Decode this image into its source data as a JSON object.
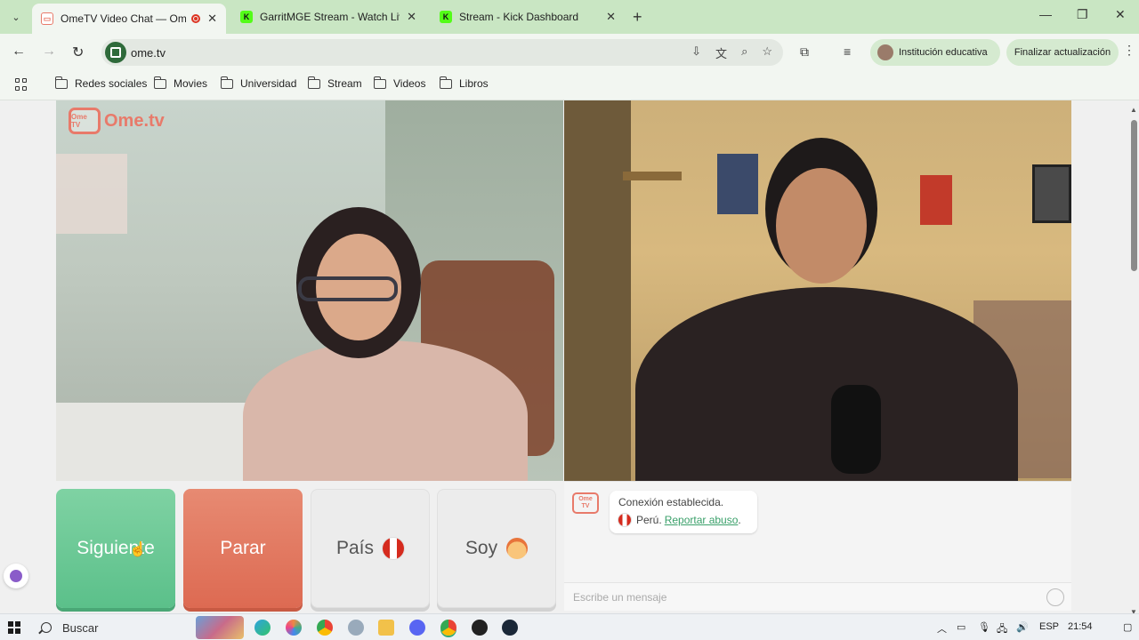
{
  "browser": {
    "tabs": [
      {
        "title": "OmeTV Video Chat — Ome",
        "active": true,
        "recording": true
      },
      {
        "title": "GarritMGE Stream - Watch Live",
        "active": false,
        "favicon_letter": "K"
      },
      {
        "title": "Stream - Kick Dashboard",
        "active": false,
        "favicon_letter": "K"
      }
    ],
    "url": "ome.tv",
    "profile_label": "Institución educativa",
    "update_label": "Finalizar actualización",
    "bookmarks": [
      "Redes sociales",
      "Movies",
      "Universidad",
      "Stream",
      "Videos",
      "Libros"
    ]
  },
  "page": {
    "logo_text": "Ome.tv",
    "logo_box_text": "Ome TV",
    "buttons": {
      "next": "Siguiente",
      "stop": "Parar",
      "country": "País",
      "gender": "Soy"
    },
    "chat": {
      "status": "Conexión establecida.",
      "country": "Perú.",
      "report": "Reportar abuso",
      "placeholder": "Escribe un mensaje"
    }
  },
  "taskbar": {
    "search_label": "Buscar",
    "language": "ESP",
    "time": "21:54"
  },
  "colors": {
    "tabstrip": "#c9e6c3",
    "next_button": "#6cc995",
    "stop_button": "#e27860",
    "brand": "#e87a6a",
    "report_link": "#3aa06a"
  }
}
